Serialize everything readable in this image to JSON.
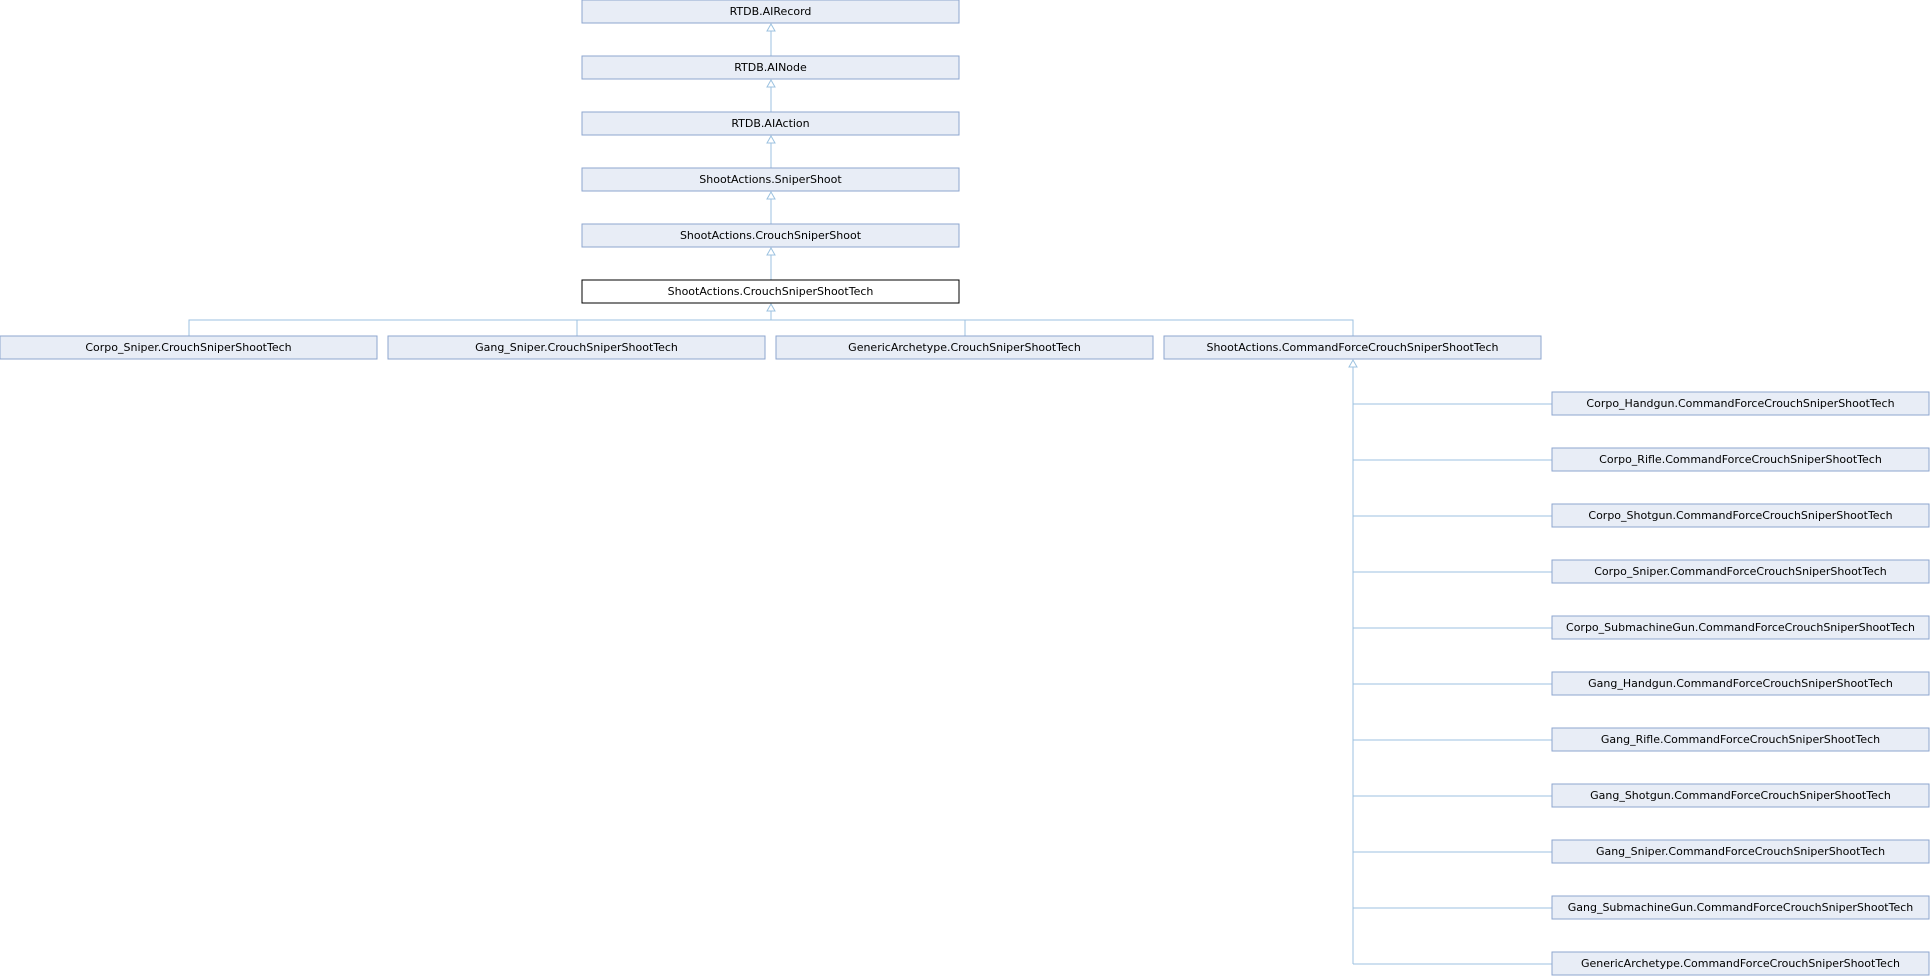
{
  "nodes": {
    "airecord": "RTDB.AIRecord",
    "ainode": "RTDB.AINode",
    "aiaction": "RTDB.AIAction",
    "snipershoot": "ShootActions.SniperShoot",
    "crouchsnipershoot": "ShootActions.CrouchSniperShoot",
    "crouchsnipershoottech": "ShootActions.CrouchSniperShootTech",
    "corpo_sniper_crouch": "Corpo_Sniper.CrouchSniperShootTech",
    "gang_sniper_crouch": "Gang_Sniper.CrouchSniperShootTech",
    "generic_crouch": "GenericArchetype.CrouchSniperShootTech",
    "commandforce": "ShootActions.CommandForceCrouchSniperShootTech",
    "corpo_handgun_cf": "Corpo_Handgun.CommandForceCrouchSniperShootTech",
    "corpo_rifle_cf": "Corpo_Rifle.CommandForceCrouchSniperShootTech",
    "corpo_shotgun_cf": "Corpo_Shotgun.CommandForceCrouchSniperShootTech",
    "corpo_sniper_cf": "Corpo_Sniper.CommandForceCrouchSniperShootTech",
    "corpo_smg_cf": "Corpo_SubmachineGun.CommandForceCrouchSniperShootTech",
    "gang_handgun_cf": "Gang_Handgun.CommandForceCrouchSniperShootTech",
    "gang_rifle_cf": "Gang_Rifle.CommandForceCrouchSniperShootTech",
    "gang_shotgun_cf": "Gang_Shotgun.CommandForceCrouchSniperShootTech",
    "gang_sniper_cf": "Gang_Sniper.CommandForceCrouchSniperShootTech",
    "gang_smg_cf": "Gang_SubmachineGun.CommandForceCrouchSniperShootTech",
    "generic_cf": "GenericArchetype.CommandForceCrouchSniperShootTech"
  },
  "colors": {
    "node_fill": "#e8edf6",
    "node_border": "#8ea6cf",
    "current_border": "#000000",
    "edge": "#9cc2e0"
  }
}
